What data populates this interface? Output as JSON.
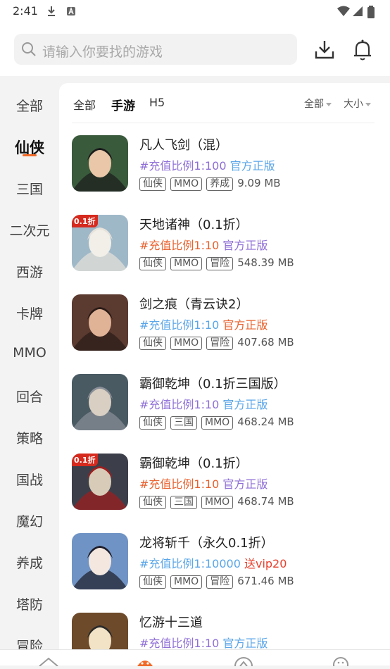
{
  "status_bar": {
    "time": "2:41"
  },
  "search": {
    "placeholder": "请输入你要找的游戏"
  },
  "sidebar": {
    "items": [
      {
        "label": "全部",
        "active": false
      },
      {
        "label": "仙侠",
        "active": true
      },
      {
        "label": "三国",
        "active": false
      },
      {
        "label": "二次元",
        "active": false
      },
      {
        "label": "西游",
        "active": false
      },
      {
        "label": "卡牌",
        "active": false
      },
      {
        "label": "MMO",
        "active": false
      },
      {
        "label": "回合",
        "active": false
      },
      {
        "label": "策略",
        "active": false
      },
      {
        "label": "国战",
        "active": false
      },
      {
        "label": "魔幻",
        "active": false
      },
      {
        "label": "养成",
        "active": false
      },
      {
        "label": "塔防",
        "active": false
      },
      {
        "label": "冒险",
        "active": false
      }
    ]
  },
  "filters": {
    "all": "全部",
    "mobile": "手游",
    "h5": "H5",
    "active": "mobile"
  },
  "sort": {
    "category": "全部",
    "size": "大小"
  },
  "colors": {
    "accent": "#f06a28",
    "purple": "#8f6fd6",
    "blue": "#5aa6e8",
    "orange": "#e8602c",
    "red": "#e83f2c"
  },
  "games": [
    {
      "name": "凡人飞剑（混）",
      "promo": [
        {
          "text": "#充值比例1:100",
          "color": "#8f6fd6"
        },
        {
          "text": " 官方正版",
          "color": "#5aa6e8"
        }
      ],
      "tags": [
        "仙侠",
        "MMO",
        "养成"
      ],
      "size": "9.09 MB",
      "badge": "",
      "icon": "character-portrait-icon"
    },
    {
      "name": "天地诸神（0.1折）",
      "promo": [
        {
          "text": "#充值比例1:10",
          "color": "#e8602c"
        },
        {
          "text": " 官方正版",
          "color": "#8f6fd6"
        }
      ],
      "tags": [
        "仙侠",
        "MMO",
        "冒险"
      ],
      "size": "548.39 MB",
      "badge": "0.1折",
      "icon": "character-portrait-icon"
    },
    {
      "name": "剑之痕（青云诀2）",
      "promo": [
        {
          "text": "#充值比例1:10",
          "color": "#5aa6e8"
        },
        {
          "text": " 官方正版",
          "color": "#e8602c"
        }
      ],
      "tags": [
        "仙侠",
        "MMO",
        "冒险"
      ],
      "size": "407.68 MB",
      "badge": "",
      "icon": "character-portrait-icon"
    },
    {
      "name": "霸御乾坤（0.1折三国版）",
      "promo": [
        {
          "text": "#充值比例1:10",
          "color": "#8f6fd6"
        },
        {
          "text": " 官方正版",
          "color": "#5aa6e8"
        }
      ],
      "tags": [
        "仙侠",
        "三国",
        "MMO"
      ],
      "size": "468.24 MB",
      "badge": "",
      "icon": "character-portrait-icon"
    },
    {
      "name": "霸御乾坤（0.1折）",
      "promo": [
        {
          "text": "#充值比例1:10",
          "color": "#e8602c"
        },
        {
          "text": " 官方正版",
          "color": "#8f6fd6"
        }
      ],
      "tags": [
        "仙侠",
        "三国",
        "MMO"
      ],
      "size": "468.74 MB",
      "badge": "0.1折",
      "icon": "character-portrait-icon"
    },
    {
      "name": "龙将斩千（永久0.1折）",
      "promo": [
        {
          "text": "#充值比例1:10000",
          "color": "#5aa6e8"
        },
        {
          "text": " 送vip20",
          "color": "#e83f2c"
        }
      ],
      "tags": [
        "仙侠",
        "MMO",
        "冒险"
      ],
      "size": "671.46 MB",
      "badge": "",
      "icon": "character-portrait-icon"
    },
    {
      "name": "忆游十三道",
      "promo": [
        {
          "text": "#充值比例1:10",
          "color": "#8f6fd6"
        },
        {
          "text": " 官方正版",
          "color": "#5aa6e8"
        }
      ],
      "tags": [],
      "size": "",
      "badge": "",
      "icon": "character-portrait-icon"
    }
  ]
}
